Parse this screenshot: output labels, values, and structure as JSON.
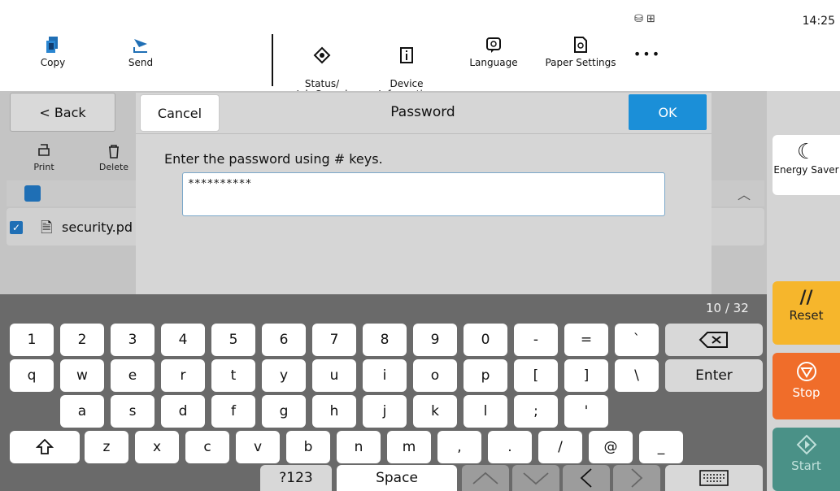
{
  "statusbar": {
    "time": "14:25",
    "icons": "⛁ ⊞"
  },
  "topbar": [
    {
      "label": "Copy"
    },
    {
      "label": "Send"
    },
    {
      "label": "Status/\nJob Cancel"
    },
    {
      "label": "Device\nInformation"
    },
    {
      "label": "Language"
    },
    {
      "label": "Paper Settings"
    },
    {
      "label": "•••"
    }
  ],
  "app": {
    "back_label": "< Back",
    "tools": [
      {
        "label": "Print"
      },
      {
        "label": "Delete"
      }
    ],
    "file_name": "security.pd"
  },
  "dialog": {
    "cancel_label": "Cancel",
    "title": "Password",
    "ok_label": "OK",
    "message": "Enter the password using # keys.",
    "password_value": "**********",
    "counter": "10 / 32"
  },
  "side": {
    "energy_label": "Energy Saver",
    "reset_label": "Reset",
    "stop_label": "Stop",
    "start_label": "Start"
  },
  "keyboard": {
    "row1": [
      "1",
      "2",
      "3",
      "4",
      "5",
      "6",
      "7",
      "8",
      "9",
      "0",
      "-",
      "=",
      "`"
    ],
    "row2": [
      "q",
      "w",
      "e",
      "r",
      "t",
      "y",
      "u",
      "i",
      "o",
      "p",
      "[",
      "]",
      "\\"
    ],
    "row3": [
      "a",
      "s",
      "d",
      "f",
      "g",
      "h",
      "j",
      "k",
      "l",
      ";",
      "'"
    ],
    "row4": [
      "z",
      "x",
      "c",
      "v",
      "b",
      "n",
      "m",
      ",",
      ".",
      "/",
      "@",
      "_"
    ],
    "enter_label": "Enter",
    "sym_label": "?123",
    "space_label": "Space"
  },
  "colors": {
    "ok": "#1b8fd8",
    "reset": "#f6b62c",
    "stop": "#f06d2a",
    "start": "#4a9187",
    "keyboard_bg": "#6a6a6a"
  }
}
